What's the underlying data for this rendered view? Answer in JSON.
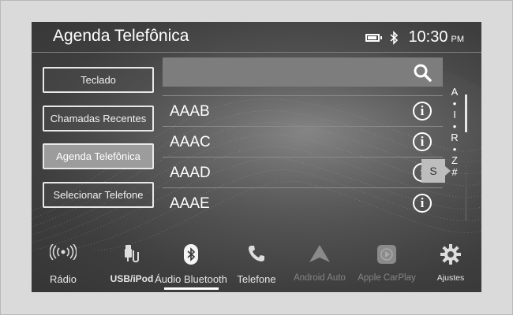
{
  "header": {
    "title": "Agenda Telefônica",
    "time": "10:30",
    "ampm": "PM",
    "battery_icon": "battery-icon",
    "bluetooth_icon": "bluetooth-icon"
  },
  "sidebar": {
    "items": [
      {
        "label": "Teclado",
        "active": false
      },
      {
        "label": "Chamadas Recentes",
        "active": false
      },
      {
        "label": "Agenda Telefônica",
        "active": true
      },
      {
        "label": "Selecionar Telefone",
        "active": false
      }
    ]
  },
  "search": {
    "icon": "search-icon"
  },
  "contacts": [
    {
      "name": "AAAB"
    },
    {
      "name": "AAAC"
    },
    {
      "name": "AAAD"
    },
    {
      "name": "AAAE"
    }
  ],
  "index": {
    "letters": [
      "A",
      "•",
      "I",
      "•",
      "R",
      "•",
      "Z",
      "#"
    ],
    "bubble": "S"
  },
  "bottom_nav": {
    "items": [
      {
        "label": "Rádio",
        "icon": "radio-icon",
        "enabled": true
      },
      {
        "label": "USB/iPod",
        "icon": "usb-icon",
        "enabled": true
      },
      {
        "label": "Áudio Bluetooth",
        "icon": "bluetooth-audio-icon",
        "enabled": true,
        "active": true
      },
      {
        "label": "Telefone",
        "icon": "phone-icon",
        "enabled": true
      },
      {
        "label": "Android Auto",
        "icon": "android-auto-icon",
        "enabled": false
      },
      {
        "label": "Apple CarPlay",
        "icon": "carplay-icon",
        "enabled": false
      },
      {
        "label": "Ajustes",
        "icon": "gear-icon",
        "enabled": true
      }
    ]
  },
  "colors": {
    "screen_bg": "#4a4a4a",
    "active_button": "#9c9c9c",
    "search_bar": "#7d7d7d"
  }
}
